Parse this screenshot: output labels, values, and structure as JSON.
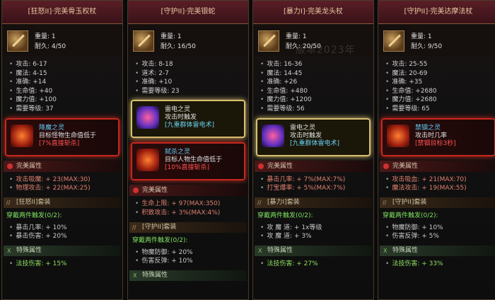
{
  "watermark": "版本2023年",
  "cards": [
    {
      "title": "[狂怒II]·完美骨玉权杖",
      "weight": "重量: 1",
      "durability": "耐久: 4/50",
      "stats": [
        "攻击: 6-17",
        "魔法: 4-15",
        "准确: +14",
        "生命值: +40",
        "魔力值: +100",
        "需要等级: 37"
      ],
      "skills": [
        {
          "name": "降魔之灵",
          "lines": [
            "目标怪物生命值低于",
            "[7%直接斩杀]"
          ],
          "style": "red"
        }
      ],
      "perfect_label": "完美属性",
      "perfect": [
        "攻击吸魔: + 23(MAX:30)",
        "物理攻击: + 22(MAX:25)"
      ],
      "set_name": "[狂怒II]套装",
      "set_trigger": "穿戴两件触发(0/2):",
      "set_bonus": [
        "暴击几率: + 10%",
        "暴击伤害: + 20%"
      ],
      "special_label": "特殊属性",
      "special": [
        "法技伤害: + 15%"
      ]
    },
    {
      "title": "[守护II]·完美银蛇",
      "weight": "重量: 1",
      "durability": "耐久: 16/50",
      "stats": [
        "攻击: 8-18",
        "道术: 2-7",
        "准确: +10",
        "需要等级: 23"
      ],
      "skills": [
        {
          "name": "雷电之灵",
          "lines": [
            "攻击时触发",
            "[九重群体雷电术]"
          ],
          "style": "gold"
        },
        {
          "name": "弑杀之灵",
          "lines": [
            "目标人物生命值低于",
            "[10%直接斩杀]"
          ],
          "style": "red"
        }
      ],
      "perfect_label": "完美属性",
      "perfect": [
        "生命上限: + 97(MAX:350)",
        "积致攻击: + 3%(MAX:4%)"
      ],
      "set_name": "[守护II]套装",
      "set_trigger": "穿戴两件触发(0/2):",
      "set_bonus": [
        "物魔防御: + 20%",
        "伤害反弹: + 10%"
      ],
      "special_label": "特殊属性",
      "special": []
    },
    {
      "title": "[暴力I]·完美龙头杖",
      "weight": "重量: 1",
      "durability": "耐久: 20/50",
      "stats": [
        "攻击: 16-36",
        "魔法: 14-45",
        "准确: +26",
        "生命值: +480",
        "魔力值: +1200",
        "需要等级: 56"
      ],
      "skills": [
        {
          "name": "雷电之灵",
          "lines": [
            "攻击时触发",
            "[九重群体雷电术]"
          ],
          "style": "gold"
        }
      ],
      "perfect_label": "完美属性",
      "perfect": [
        "暴击几率: + 7%(MAX:7%)",
        "打宝爆率: + 5%(MAX:7%)"
      ],
      "set_name": "[暴力I]套装",
      "set_trigger": "穿戴两件触发(0/2):",
      "set_bonus": [
        "攻 魔 道: + 1x等级",
        "攻 魔 道: + 3%"
      ],
      "special_label": "特殊属性",
      "special": [
        "法技伤害: + 27%"
      ]
    },
    {
      "title": "[守护II]·完美达摩法杖",
      "weight": "重量: 1",
      "durability": "耐久: 9/50",
      "stats": [
        "攻击: 25-55",
        "魔法: 20-69",
        "准确: +35",
        "生命值: +2680",
        "魔力值: +2680",
        "需要等级: 65"
      ],
      "skills": [
        {
          "name": "禁锢之灵",
          "lines": [
            "攻击时几率",
            "[禁锢目标3秒]"
          ],
          "style": "red"
        }
      ],
      "perfect_label": "完美属性",
      "perfect": [
        "攻击吸血: + 21(MAX:70)",
        "魔法攻击: + 19(MAX:55)"
      ],
      "set_name": "[守护II]套装",
      "set_trigger": "穿戴两件触发(0/2):",
      "set_bonus": [
        "物魔防御: + 10%",
        "伤害反弹: + 5%"
      ],
      "special_label": "特殊属性",
      "special": [
        "法技伤害: + 33%"
      ]
    }
  ]
}
